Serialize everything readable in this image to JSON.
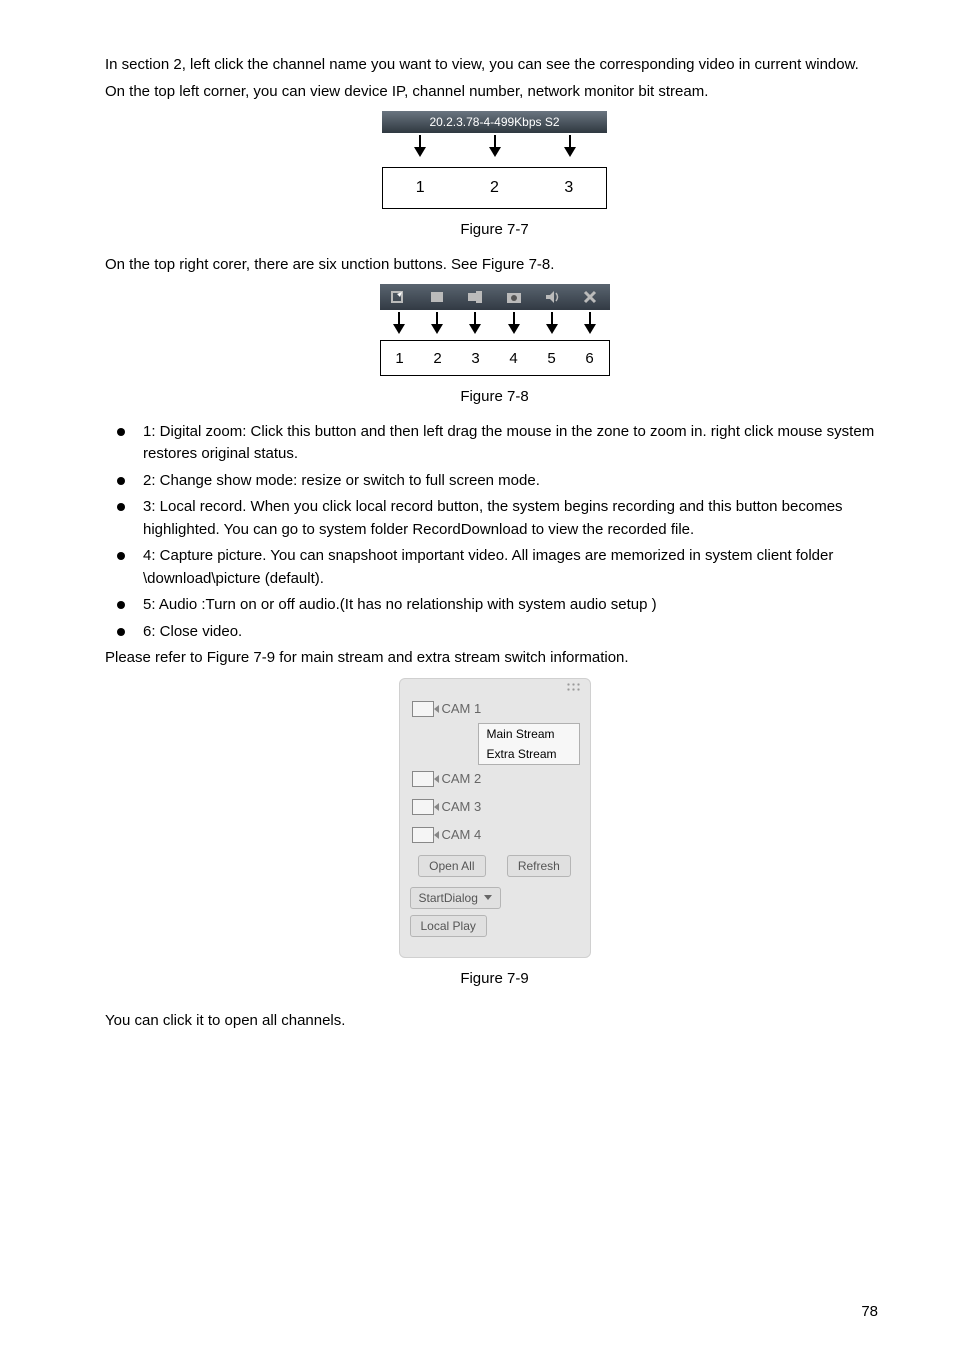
{
  "para1_pre": " In section 2, left click the channel name you want to view, you can see the corresponding video in current window.",
  "para1b": "On the top left corner, you can view device IP, channel number, network monitor bit stream.",
  "stream_header": "20.2.3.78-4-499Kbps S2",
  "fig77_nums": [
    "1",
    "2",
    "3"
  ],
  "fig77_caption": "Figure 7-7",
  "para2": "On the top right corer, there are six unction buttons. See Figure 7-8.",
  "fig78_nums": [
    "1",
    "2",
    "3",
    "4",
    "5",
    "6"
  ],
  "fig78_caption": "Figure 7-8",
  "bullets": [
    "1: Digital zoom: Click this button and then left drag the mouse in the zone to zoom in. right click mouse system restores original status.",
    "2: Change show mode: resize or switch to full screen mode.",
    "3: Local record. When you click local record button, the system begins recording and this button becomes highlighted. You can go to system folder RecordDownload to view the recorded file.",
    "4: Capture picture. You can snapshoot important video. All images are memorized in system client folder \\download\\picture (default).",
    "5: Audio :Turn on or off audio.(It has no relationship with system audio setup )",
    "6: Close video."
  ],
  "para3": "Please refer to Figure 7-9 for main stream and extra stream switch information.",
  "panel": {
    "cam1": "CAM 1",
    "main_stream": "Main Stream",
    "extra_stream": "Extra Stream",
    "cam2": "CAM 2",
    "cam3": "CAM 3",
    "cam4": "CAM 4",
    "open_all": "Open All",
    "refresh": "Refresh",
    "start_dialog": "StartDialog",
    "local_play": "Local Play"
  },
  "fig79_caption": "Figure 7-9",
  "para4": "You can click it to open all channels.",
  "page_num": "78",
  "chart_data": [
    {
      "type": "table",
      "title": "Figure 7-7 top-left overlay callouts",
      "categories": [
        "1",
        "2",
        "3"
      ],
      "values": [
        "Device IP (20.2.3.78)",
        "Channel number (4)",
        "Network monitor bit stream (499Kbps S2)"
      ]
    },
    {
      "type": "table",
      "title": "Figure 7-8 top-right button bar callouts",
      "categories": [
        "1",
        "2",
        "3",
        "4",
        "5",
        "6"
      ],
      "values": [
        "Digital zoom",
        "Change show mode",
        "Local record",
        "Capture picture",
        "Audio on/off",
        "Close video"
      ]
    }
  ]
}
